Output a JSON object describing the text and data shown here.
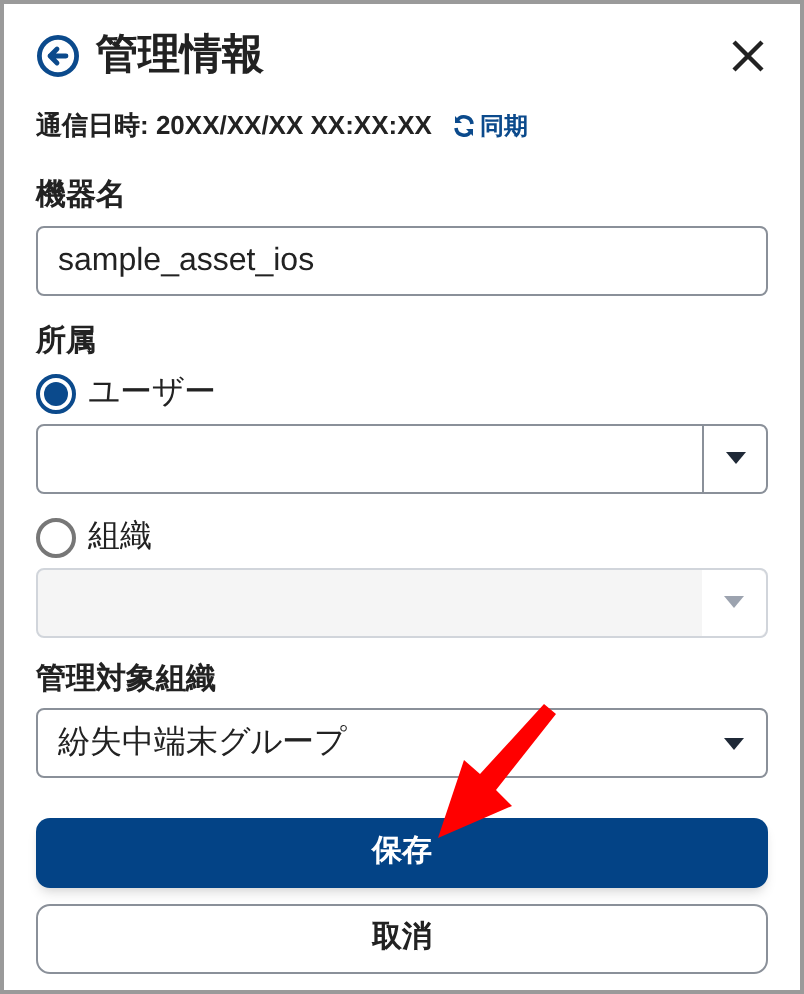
{
  "header": {
    "title": "管理情報"
  },
  "sync": {
    "text": "通信日時: 20XX/XX/XX XX:XX:XX",
    "link": "同期"
  },
  "device_name": {
    "label": "機器名",
    "value": "sample_asset_ios"
  },
  "affiliation": {
    "label": "所属",
    "options": [
      {
        "label": "ユーザー",
        "selected": true,
        "select": {
          "disabled": false
        }
      },
      {
        "label": "組織",
        "selected": false,
        "select": {
          "disabled": true
        }
      }
    ]
  },
  "managed_org": {
    "label": "管理対象組織",
    "value": "紛失中端末グループ"
  },
  "buttons": [
    {
      "label": "保存",
      "kind": "primary"
    },
    {
      "label": "取消",
      "kind": "secondary"
    }
  ]
}
